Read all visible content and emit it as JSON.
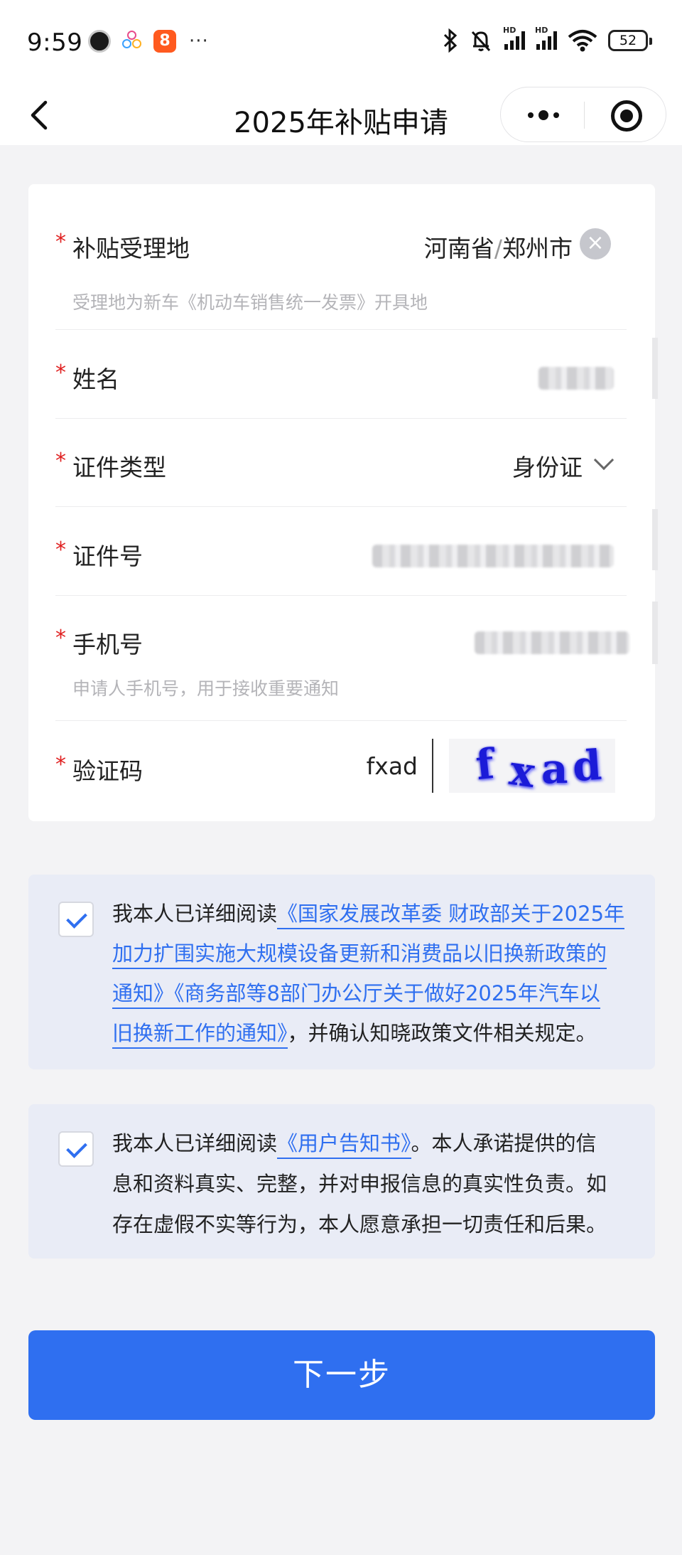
{
  "status_bar": {
    "time": "9:59",
    "more": "···",
    "battery": "52",
    "signal_tag": "HD"
  },
  "nav": {
    "title": "2025年补贴申请"
  },
  "form": {
    "location": {
      "required_mark": "*",
      "label": "补贴受理地",
      "value_province": "河南省",
      "value_sep": "/",
      "value_city": "郑州市",
      "hint": "受理地为新车《机动车销售统一发票》开具地"
    },
    "name": {
      "required_mark": "*",
      "label": "姓名"
    },
    "id_type": {
      "required_mark": "*",
      "label": "证件类型",
      "value": "身份证"
    },
    "id_number": {
      "required_mark": "*",
      "label": "证件号"
    },
    "phone": {
      "required_mark": "*",
      "label": "手机号",
      "hint": "申请人手机号，用于接收重要通知"
    },
    "captcha": {
      "required_mark": "*",
      "label": "验证码",
      "value": "fxad",
      "image_text": [
        "f",
        "x",
        "a",
        "d"
      ]
    }
  },
  "agreement1": {
    "checked": true,
    "line1_prefix": "我本人已详细阅读",
    "line1_link": "《国家发展改革委 财政部关于2025年",
    "line2_link": "加力扩围实施大规模设备更新和消费品以旧换新政策的",
    "line3_link": "通知》《商务部等8部门办公厅关于做好2025年汽车以",
    "line4_link": "旧换新工作的通知》",
    "line4_suffix": "，并确认知晓政策文件相关规定。"
  },
  "agreement2": {
    "checked": true,
    "line1_prefix": "我本人已详细阅读",
    "line1_link": "《用户告知书》",
    "line1_suffix": "。本人承诺提供的信",
    "line2": "息和资料真实、完整，并对申报信息的真实性负责。如",
    "line3": "存在虚假不实等行为，本人愿意承担一切责任和后果。"
  },
  "next_button": {
    "label": "下一步"
  },
  "colors": {
    "primary": "#2f6ff0",
    "required": "#e02020",
    "page_bg": "#f3f3f5",
    "agree_bg": "#e9ecf6"
  }
}
